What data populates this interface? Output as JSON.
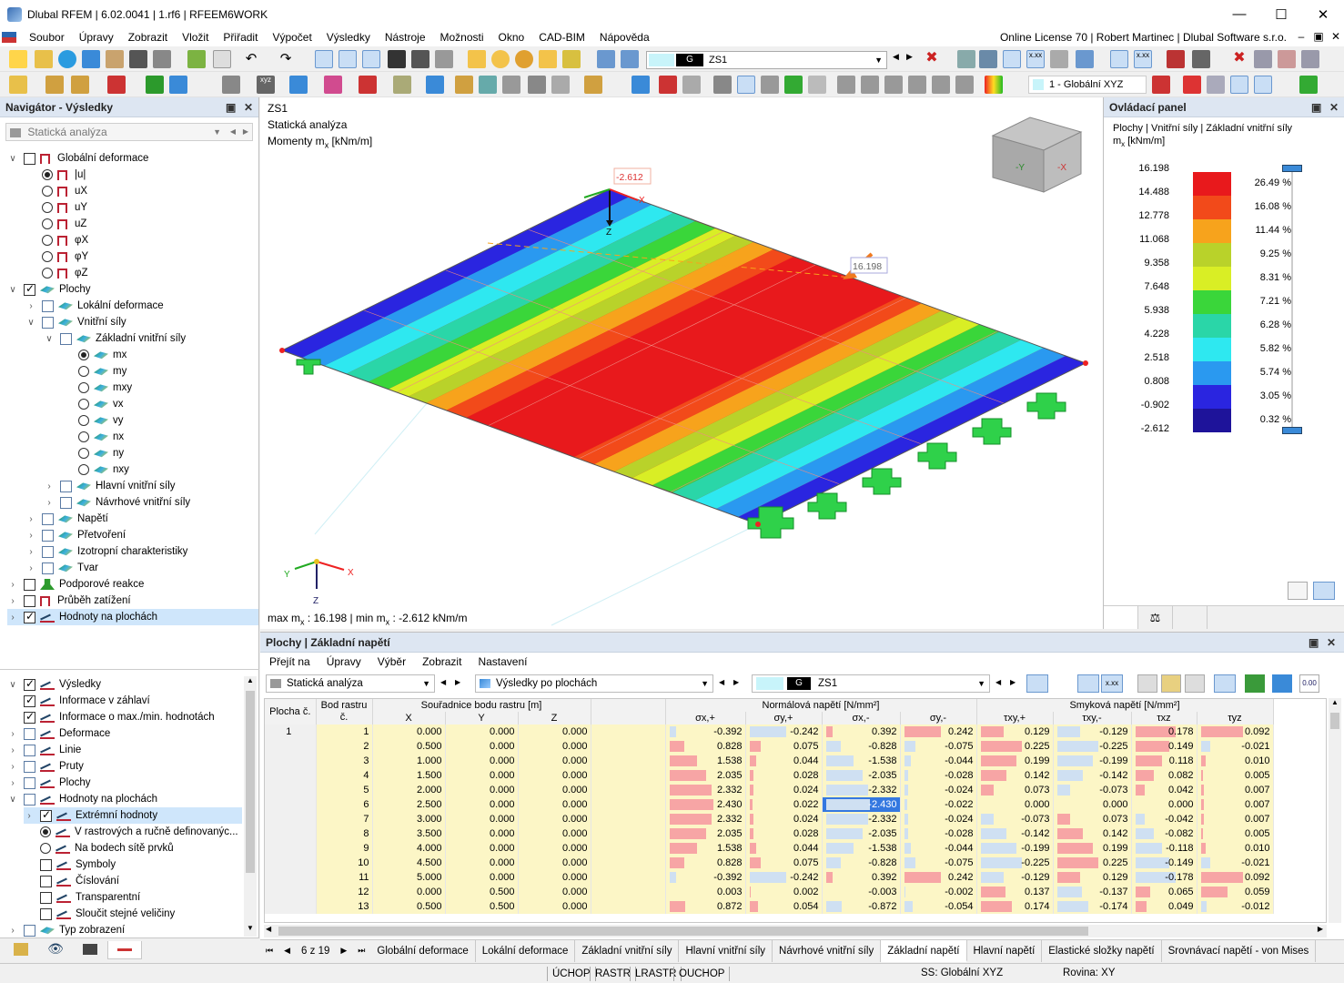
{
  "titlebar": {
    "title": "Dlubal RFEM | 6.02.0041 | 1.rf6 | RFEEM6WORK"
  },
  "menu": {
    "items": [
      "Soubor",
      "Úpravy",
      "Zobrazit",
      "Vložit",
      "Přiřadit",
      "Výpočet",
      "Výsledky",
      "Nástroje",
      "Možnosti",
      "Okno",
      "CAD-BIM",
      "Nápověda"
    ],
    "license": "Online License 70 | Robert Martinec | Dlubal Software s.r.o."
  },
  "toolbar": {
    "lc_code": "G",
    "lc_name": "ZS1",
    "coord_system": "1 - Globální XYZ"
  },
  "navigator": {
    "title": "Navigátor - Výsledky",
    "analysis": "Statická analýza",
    "tree": [
      "Globální deformace",
      "|u|",
      "uX",
      "uY",
      "uZ",
      "φX",
      "φY",
      "φZ",
      "Plochy",
      "Lokální deformace",
      "Vnitřní síly",
      "Základní vnitřní síly",
      "mx",
      "my",
      "mxy",
      "vx",
      "vy",
      "nx",
      "ny",
      "nxy",
      "Hlavní vnitřní síly",
      "Návrhové vnitřní síly",
      "Napětí",
      "Přetvoření",
      "Izotropní charakteristiky",
      "Tvar",
      "Podporové reakce",
      "Průběh zatížení",
      "Hodnoty na plochách"
    ],
    "lower": [
      "Výsledky",
      "Informace v záhlaví",
      "Informace o max./min. hodnotách",
      "Deformace",
      "Linie",
      "Pruty",
      "Plochy",
      "Hodnoty na plochách",
      "Extrémní hodnoty",
      "V rastrových a ručně definovanýc...",
      "Na bodech sítě prvků",
      "Symboly",
      "Číslování",
      "Transparentní",
      "Sloučit stejné veličiny",
      "Typ zobrazení"
    ]
  },
  "view": {
    "lc": "ZS1",
    "analysis": "Statická analýza",
    "quantity": "Momenty m",
    "quantity_sub": "x",
    "unit": " [kNm/m]",
    "min_label": "-2.612",
    "max_label": "16.198",
    "summary_a": "max m",
    "summary_b": " : 16.198 | min m",
    "summary_c": " : -2.612 kNm/m",
    "axes": {
      "x": "X",
      "y": "Y",
      "z": "Z"
    }
  },
  "control_panel": {
    "title": "Ovládací panel",
    "subtitle": "Plochy | Vnitřní síly | Základní vnitřní síly",
    "quantity": "m",
    "quantity_sub": "x",
    "unit": " [kNm/m]",
    "legend": [
      {
        "value": "16.198",
        "color": "#e8191c",
        "pct": "26.49 %"
      },
      {
        "value": "14.488",
        "color": "#f24a1a",
        "pct": "16.08 %"
      },
      {
        "value": "12.778",
        "color": "#f7a31c",
        "pct": "11.44 %"
      },
      {
        "value": "11.068",
        "color": "#b9d22a",
        "pct": "9.25 %"
      },
      {
        "value": "9.358",
        "color": "#d9ee25",
        "pct": "8.31 %"
      },
      {
        "value": "7.648",
        "color": "#3ad63a",
        "pct": "7.21 %"
      },
      {
        "value": "5.938",
        "color": "#2ad6a8",
        "pct": "6.28 %"
      },
      {
        "value": "4.228",
        "color": "#2ee8f0",
        "pct": "5.82 %"
      },
      {
        "value": "2.518",
        "color": "#2a99f0",
        "pct": "5.74 %"
      },
      {
        "value": "0.808",
        "color": "#2a25e0",
        "pct": "3.05 %"
      },
      {
        "value": "-0.902",
        "color": "#1e139a",
        "pct": "0.32 %"
      }
    ],
    "last_value": "-2.612"
  },
  "results": {
    "title": "Plochy | Základní napětí",
    "menu": [
      "Přejít na",
      "Úpravy",
      "Výběr",
      "Zobrazit",
      "Nastavení"
    ],
    "analysis": "Statická analýza",
    "results_by": "Výsledky po plochách",
    "lc_code": "G",
    "lc_name": "ZS1",
    "headers": {
      "plocha": "Plocha č.",
      "bod": "Bod rastru č.",
      "coords": "Souřadnice bodu rastru [m]",
      "normal": "Normálová napětí [N/mm²]",
      "shear": "Smyková napětí [N/mm²]",
      "cols": [
        "X",
        "Y",
        "Z",
        "σx,+",
        "σy,+",
        "σx,-",
        "σy,-",
        "τxy,+",
        "τxy,-",
        "τxz",
        "τyz"
      ]
    },
    "rows": [
      [
        "1",
        "1",
        "0.000",
        "0.000",
        "0.000",
        "-0.392",
        "-0.242",
        "0.392",
        "0.242",
        "0.129",
        "-0.129",
        "0.178",
        "0.092"
      ],
      [
        "",
        "2",
        "0.500",
        "0.000",
        "0.000",
        "0.828",
        "0.075",
        "-0.828",
        "-0.075",
        "0.225",
        "-0.225",
        "0.149",
        "-0.021"
      ],
      [
        "",
        "3",
        "1.000",
        "0.000",
        "0.000",
        "1.538",
        "0.044",
        "-1.538",
        "-0.044",
        "0.199",
        "-0.199",
        "0.118",
        "0.010"
      ],
      [
        "",
        "4",
        "1.500",
        "0.000",
        "0.000",
        "2.035",
        "0.028",
        "-2.035",
        "-0.028",
        "0.142",
        "-0.142",
        "0.082",
        "0.005"
      ],
      [
        "",
        "5",
        "2.000",
        "0.000",
        "0.000",
        "2.332",
        "0.024",
        "-2.332",
        "-0.024",
        "0.073",
        "-0.073",
        "0.042",
        "0.007"
      ],
      [
        "",
        "6",
        "2.500",
        "0.000",
        "0.000",
        "2.430",
        "0.022",
        "-2.430",
        "-0.022",
        "0.000",
        "0.000",
        "0.000",
        "0.007"
      ],
      [
        "",
        "7",
        "3.000",
        "0.000",
        "0.000",
        "2.332",
        "0.024",
        "-2.332",
        "-0.024",
        "-0.073",
        "0.073",
        "-0.042",
        "0.007"
      ],
      [
        "",
        "8",
        "3.500",
        "0.000",
        "0.000",
        "2.035",
        "0.028",
        "-2.035",
        "-0.028",
        "-0.142",
        "0.142",
        "-0.082",
        "0.005"
      ],
      [
        "",
        "9",
        "4.000",
        "0.000",
        "0.000",
        "1.538",
        "0.044",
        "-1.538",
        "-0.044",
        "-0.199",
        "0.199",
        "-0.118",
        "0.010"
      ],
      [
        "",
        "10",
        "4.500",
        "0.000",
        "0.000",
        "0.828",
        "0.075",
        "-0.828",
        "-0.075",
        "-0.225",
        "0.225",
        "-0.149",
        "-0.021"
      ],
      [
        "",
        "11",
        "5.000",
        "0.000",
        "0.000",
        "-0.392",
        "-0.242",
        "0.392",
        "0.242",
        "-0.129",
        "0.129",
        "-0.178",
        "0.092"
      ],
      [
        "",
        "12",
        "0.000",
        "0.500",
        "0.000",
        "0.003",
        "0.002",
        "-0.003",
        "-0.002",
        "0.137",
        "-0.137",
        "0.065",
        "0.059"
      ],
      [
        "",
        "13",
        "0.500",
        "0.500",
        "0.000",
        "0.872",
        "0.054",
        "-0.872",
        "-0.054",
        "0.174",
        "-0.174",
        "0.049",
        "-0.012"
      ]
    ],
    "pager": "6 z 19",
    "tabs": [
      "Globální deformace",
      "Lokální deformace",
      "Základní vnitřní síly",
      "Hlavní vnitřní síly",
      "Návrhové vnitřní síly",
      "Základní napětí",
      "Hlavní napětí",
      "Elastické složky napětí",
      "Srovnávací napětí - von Mises"
    ]
  },
  "statusbar": {
    "items": [
      "ÚCHOP",
      "RASTR",
      "LRASTR",
      "OUCHOP"
    ],
    "cs": "SS: Globální XYZ",
    "plane": "Rovina: XY"
  }
}
